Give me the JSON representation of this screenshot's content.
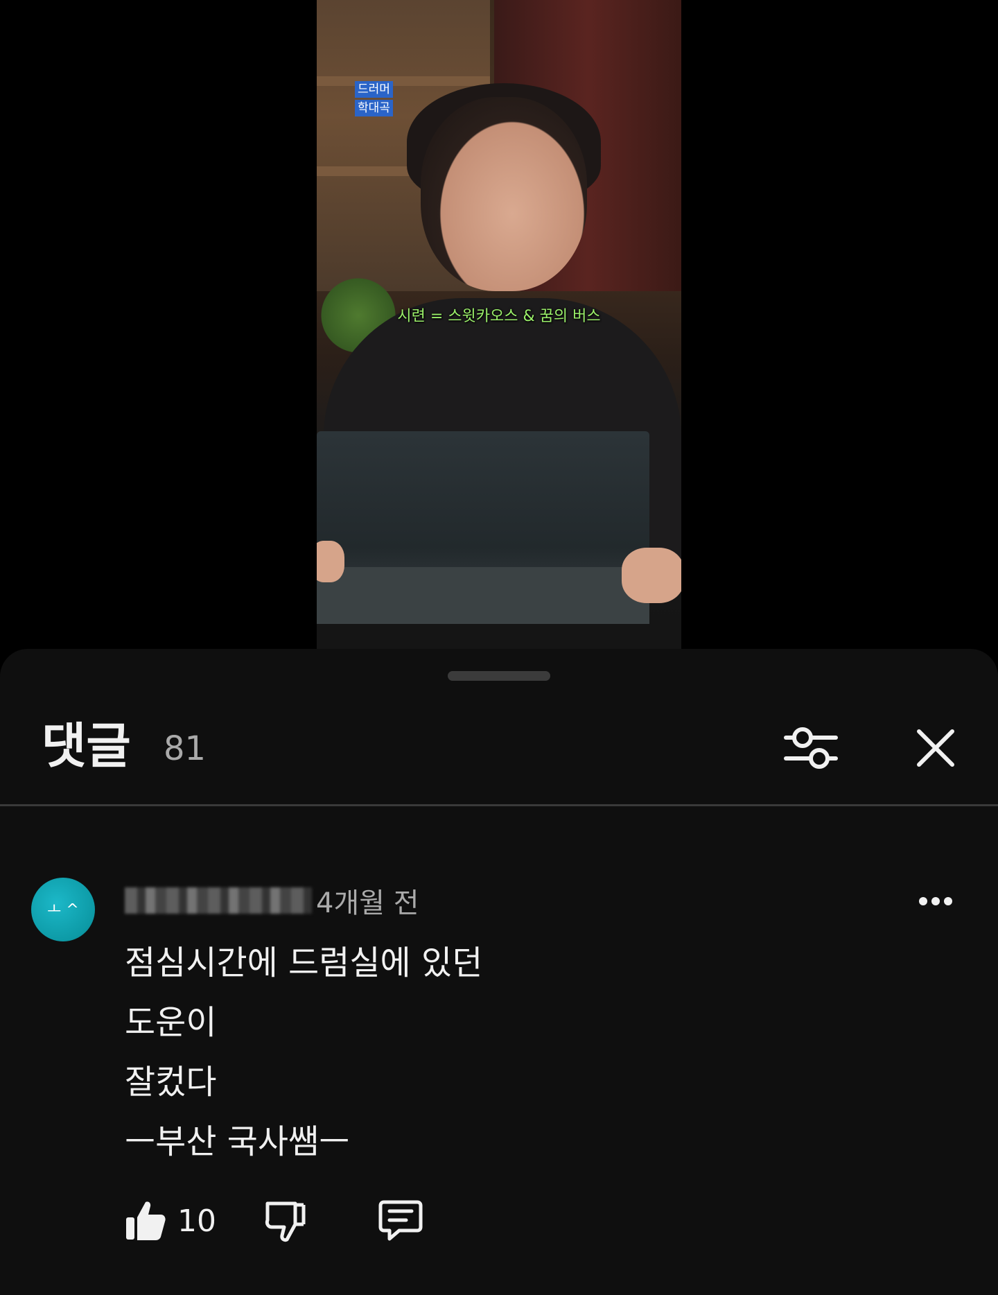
{
  "video": {
    "tags": [
      "드러머",
      "학대곡"
    ],
    "caption": "시련 = 스윗카오스 & 꿈의 버스"
  },
  "comments_panel": {
    "title": "댓글",
    "count": "81",
    "icons": {
      "filter": "sliders-icon",
      "close": "close-icon",
      "more": "more-horizontal-icon",
      "like": "thumbs-up-icon",
      "dislike": "thumbs-down-icon",
      "reply": "comment-reply-icon"
    },
    "comment": {
      "avatar_initial": "ㅗ ^",
      "author": "",
      "time": "4개월 전",
      "lines": [
        "점심시간에 드럼실에 있던",
        "도운이",
        "잘컸다",
        "ㅡ부산 국사쌤ㅡ"
      ],
      "likes": "10"
    }
  },
  "colors": {
    "sheet_bg": "#0f0f0f",
    "text_primary": "#f1f1f1",
    "text_secondary": "#aaaaaa",
    "avatar": "#0d9aa6",
    "caption": "#9bf06a"
  }
}
